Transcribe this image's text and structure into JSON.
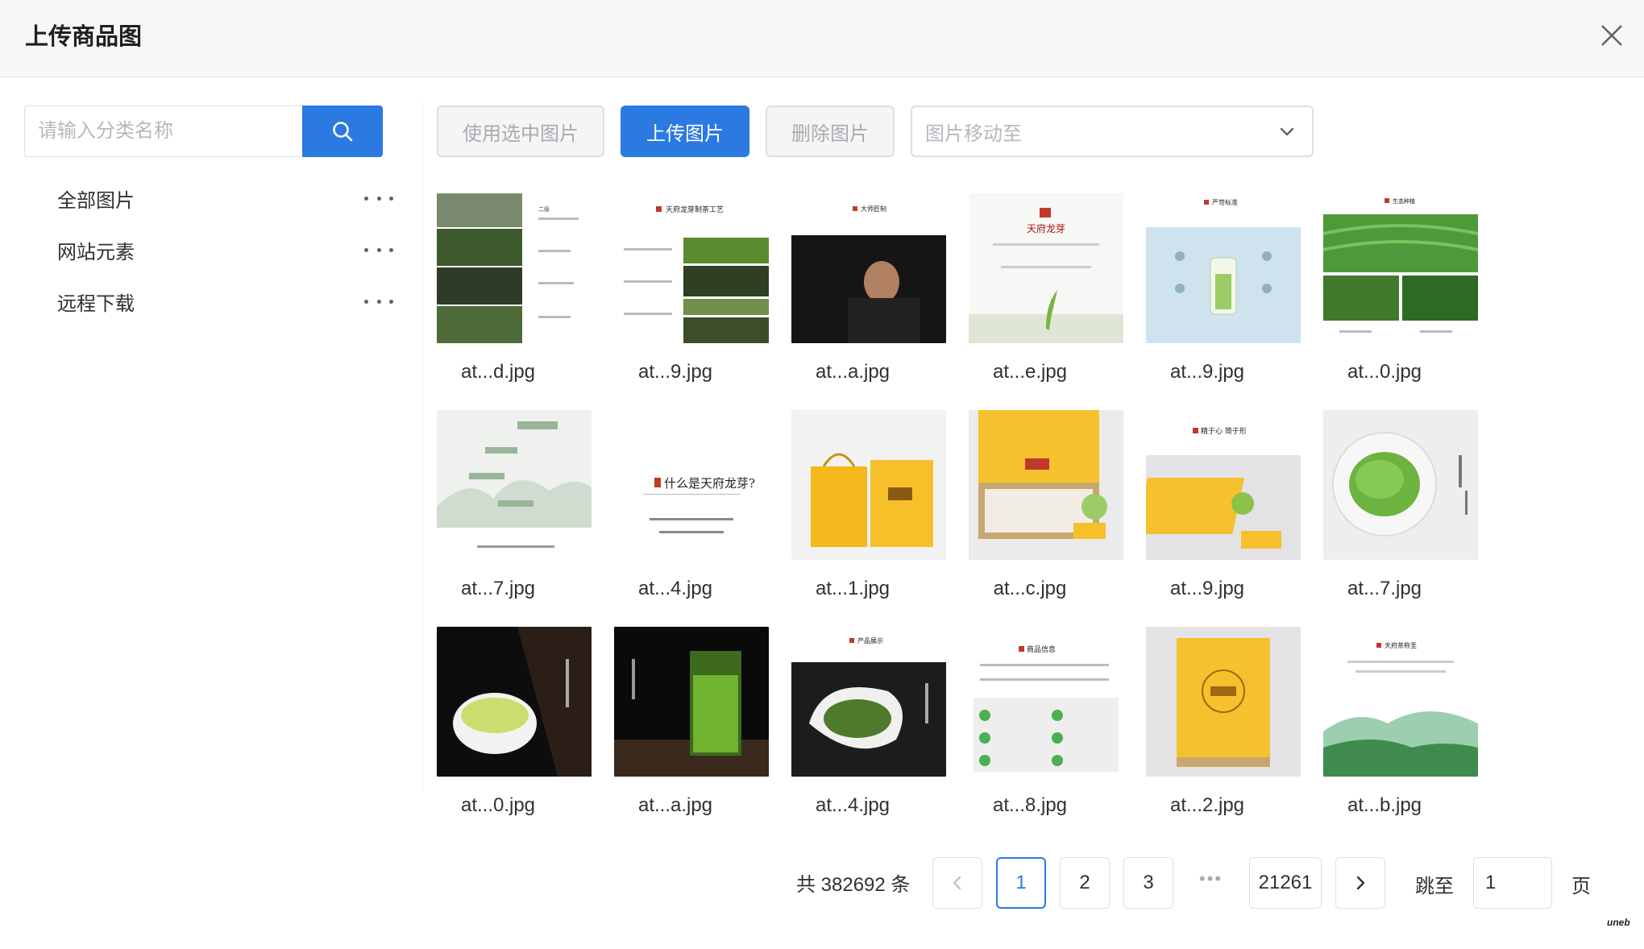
{
  "dialog": {
    "title": "上传商品图"
  },
  "sidebar": {
    "search_placeholder": "请输入分类名称",
    "categories": [
      {
        "label": "全部图片"
      },
      {
        "label": "网站元素"
      },
      {
        "label": "远程下载"
      }
    ]
  },
  "toolbar": {
    "use_selected": "使用选中图片",
    "upload": "上传图片",
    "delete": "删除图片",
    "move_placeholder": "图片移动至"
  },
  "images": [
    {
      "name": "at...d.jpg",
      "thumb_text": "二级"
    },
    {
      "name": "at...9.jpg",
      "thumb_text": "天府龙芽制茶工艺"
    },
    {
      "name": "at...a.jpg",
      "thumb_text": "大师匠制"
    },
    {
      "name": "at...e.jpg",
      "thumb_text": "天府龙芽"
    },
    {
      "name": "at...9.jpg",
      "thumb_text": "严苛标准"
    },
    {
      "name": "at...0.jpg",
      "thumb_text": "生态种植"
    },
    {
      "name": "at...7.jpg",
      "thumb_text": ""
    },
    {
      "name": "at...4.jpg",
      "thumb_text": "什么是天府龙芽?"
    },
    {
      "name": "at...1.jpg",
      "thumb_text": ""
    },
    {
      "name": "at...c.jpg",
      "thumb_text": ""
    },
    {
      "name": "at...9.jpg",
      "thumb_text": "精于心 简于形"
    },
    {
      "name": "at...7.jpg",
      "thumb_text": ""
    },
    {
      "name": "at...0.jpg",
      "thumb_text": ""
    },
    {
      "name": "at...a.jpg",
      "thumb_text": ""
    },
    {
      "name": "at...4.jpg",
      "thumb_text": "产品展示"
    },
    {
      "name": "at...8.jpg",
      "thumb_text": "商品信息"
    },
    {
      "name": "at...2.jpg",
      "thumb_text": ""
    },
    {
      "name": "at...b.jpg",
      "thumb_text": "天府茶称圣"
    }
  ],
  "pagination": {
    "total": "共 382692 条",
    "pages": [
      "1",
      "2",
      "3"
    ],
    "ellipsis": "•••",
    "last": "21261",
    "jump_label": "跳至",
    "jump_value": "1",
    "unit": "页"
  },
  "watermark": "uneb",
  "colors": {
    "primary": "#2a7ae2",
    "border": "#dcdfe6",
    "header_bg": "#f7f7f7"
  }
}
